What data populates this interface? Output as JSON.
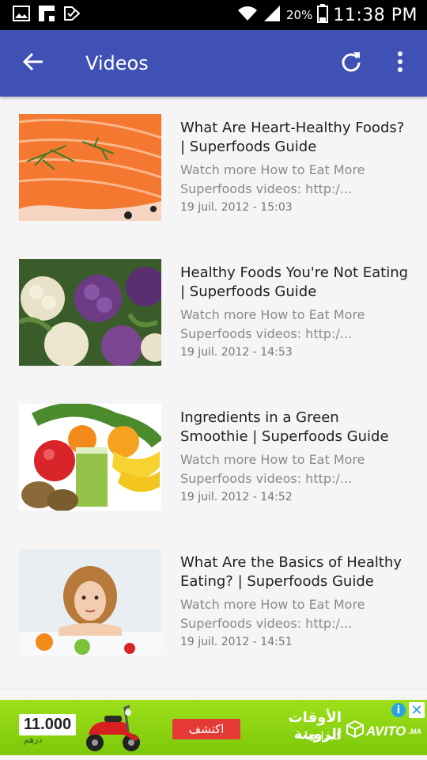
{
  "status_bar": {
    "battery_percent": "20%",
    "time": "11:38 PM",
    "left_icons": [
      "gallery-icon",
      "flipboard-icon",
      "check-notification-icon"
    ],
    "right_icons": [
      "wifi-icon",
      "signal-icon",
      "battery-icon"
    ]
  },
  "toolbar": {
    "title": "Videos",
    "color": "#3f51b5",
    "back_icon": "arrow-back-icon",
    "refresh_icon": "refresh-icon",
    "more_icon": "more-vert-icon"
  },
  "videos": [
    {
      "title": "What Are Heart-Healthy Foods? | Superfoods Guide",
      "description": "Watch more How to Eat More Superfoods videos: http:/...",
      "date": "19 juil. 2012 - 15:03",
      "thumbnail": "salmon-thumbnail"
    },
    {
      "title": "Healthy Foods You're Not Eating | Superfoods Guide",
      "description": "Watch more How to Eat More Superfoods videos: http:/...",
      "date": "19 juil. 2012 - 14:53",
      "thumbnail": "cauliflower-thumbnail"
    },
    {
      "title": "Ingredients in a Green Smoothie | Superfoods Guide",
      "description": "Watch more How to Eat More Superfoods videos: http:/...",
      "date": "19 juil. 2012 - 14:52",
      "thumbnail": "smoothie-fruits-thumbnail"
    },
    {
      "title": "What Are the Basics of Healthy Eating? | Superfoods Guide",
      "description": "Watch more How to Eat More Superfoods videos: http:/...",
      "date": "19 juil. 2012 - 14:51",
      "thumbnail": "woman-fruit-thumbnail"
    }
  ],
  "ad": {
    "price": "11.000",
    "currency": "درهم",
    "cta": "اكتشف",
    "headline": "الأوقات الزوينة",
    "subline": "كتبدا هنا",
    "brand": "AVITO",
    "brand_suffix": ".MA",
    "color": "#8fd614"
  }
}
